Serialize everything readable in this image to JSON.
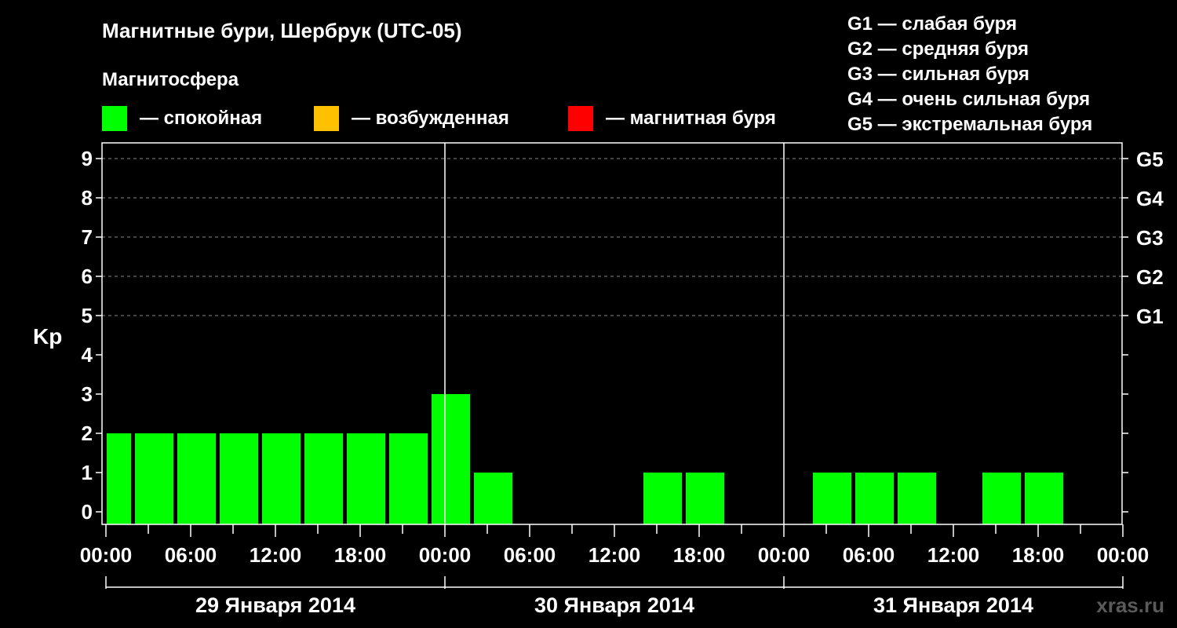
{
  "header": {
    "title": "Магнитные бури, Шербрук (UTC-05)",
    "subtitle": "Магнитосфера",
    "watermark": "xras.ru"
  },
  "legend_states": [
    {
      "label": "— спокойная",
      "color": "#00ff00"
    },
    {
      "label": "— возбужденная",
      "color": "#ffc000"
    },
    {
      "label": "— магнитная буря",
      "color": "#ff0000"
    }
  ],
  "g_scale": [
    "G1 — слабая буря",
    "G2 — средняя буря",
    "G3 — сильная буря",
    "G4 — очень сильная буря",
    "G5 — экстремальная буря"
  ],
  "chart_data": {
    "type": "bar",
    "ylabel": "Kp",
    "ylim": [
      0,
      9
    ],
    "yticks": [
      "0",
      "1",
      "2",
      "3",
      "4",
      "5",
      "6",
      "7",
      "8",
      "9"
    ],
    "right_ticks": [
      {
        "kp": 5,
        "label": "G1"
      },
      {
        "kp": 6,
        "label": "G2"
      },
      {
        "kp": 7,
        "label": "G3"
      },
      {
        "kp": 8,
        "label": "G4"
      },
      {
        "kp": 9,
        "label": "G5"
      }
    ],
    "xtick_labels": [
      "00:00",
      "06:00",
      "12:00",
      "18:00",
      "00:00",
      "06:00",
      "12:00",
      "18:00",
      "00:00",
      "06:00",
      "12:00",
      "18:00",
      "00:00"
    ],
    "days": [
      "29 Января 2014",
      "30 Января 2014",
      "31 Января 2014"
    ],
    "grid": "dashed at Kp 5-9",
    "bar_colors": {
      "quiet": "#00ff00",
      "active": "#ffc000",
      "storm": "#ff0000"
    },
    "series": [
      {
        "day": "29 Января 2014",
        "start_hour": 0,
        "end_hour": 2,
        "kp": 2
      },
      {
        "day": "29 Января 2014",
        "start_hour": 2,
        "end_hour": 5,
        "kp": 2
      },
      {
        "day": "29 Января 2014",
        "start_hour": 5,
        "end_hour": 8,
        "kp": 2
      },
      {
        "day": "29 Января 2014",
        "start_hour": 8,
        "end_hour": 11,
        "kp": 2
      },
      {
        "day": "29 Января 2014",
        "start_hour": 11,
        "end_hour": 14,
        "kp": 2
      },
      {
        "day": "29 Января 2014",
        "start_hour": 14,
        "end_hour": 17,
        "kp": 2
      },
      {
        "day": "29 Января 2014",
        "start_hour": 17,
        "end_hour": 20,
        "kp": 2
      },
      {
        "day": "29 Января 2014",
        "start_hour": 20,
        "end_hour": 23,
        "kp": 2
      },
      {
        "day": "29 Января 2014",
        "start_hour": 23,
        "end_hour": 26,
        "kp": 3
      },
      {
        "day": "30 Января 2014",
        "start_hour": 26,
        "end_hour": 29,
        "kp": 1
      },
      {
        "day": "30 Января 2014",
        "start_hour": 29,
        "end_hour": 32,
        "kp": 0
      },
      {
        "day": "30 Января 2014",
        "start_hour": 32,
        "end_hour": 35,
        "kp": 0
      },
      {
        "day": "30 Января 2014",
        "start_hour": 35,
        "end_hour": 38,
        "kp": 0
      },
      {
        "day": "30 Января 2014",
        "start_hour": 38,
        "end_hour": 41,
        "kp": 1
      },
      {
        "day": "30 Января 2014",
        "start_hour": 41,
        "end_hour": 44,
        "kp": 1
      },
      {
        "day": "30 Января 2014",
        "start_hour": 44,
        "end_hour": 47,
        "kp": 0
      },
      {
        "day": "30 Января 2014",
        "start_hour": 47,
        "end_hour": 50,
        "kp": 0
      },
      {
        "day": "31 Января 2014",
        "start_hour": 50,
        "end_hour": 53,
        "kp": 1
      },
      {
        "day": "31 Января 2014",
        "start_hour": 53,
        "end_hour": 56,
        "kp": 1
      },
      {
        "day": "31 Января 2014",
        "start_hour": 56,
        "end_hour": 59,
        "kp": 1
      },
      {
        "day": "31 Января 2014",
        "start_hour": 59,
        "end_hour": 62,
        "kp": 0
      },
      {
        "day": "31 Января 2014",
        "start_hour": 62,
        "end_hour": 65,
        "kp": 1
      },
      {
        "day": "31 Января 2014",
        "start_hour": 65,
        "end_hour": 68,
        "kp": 1
      },
      {
        "day": "31 Января 2014",
        "start_hour": 68,
        "end_hour": 71,
        "kp": 0
      },
      {
        "day": "31 Января 2014",
        "start_hour": 71,
        "end_hour": 72,
        "kp": 0
      }
    ]
  }
}
